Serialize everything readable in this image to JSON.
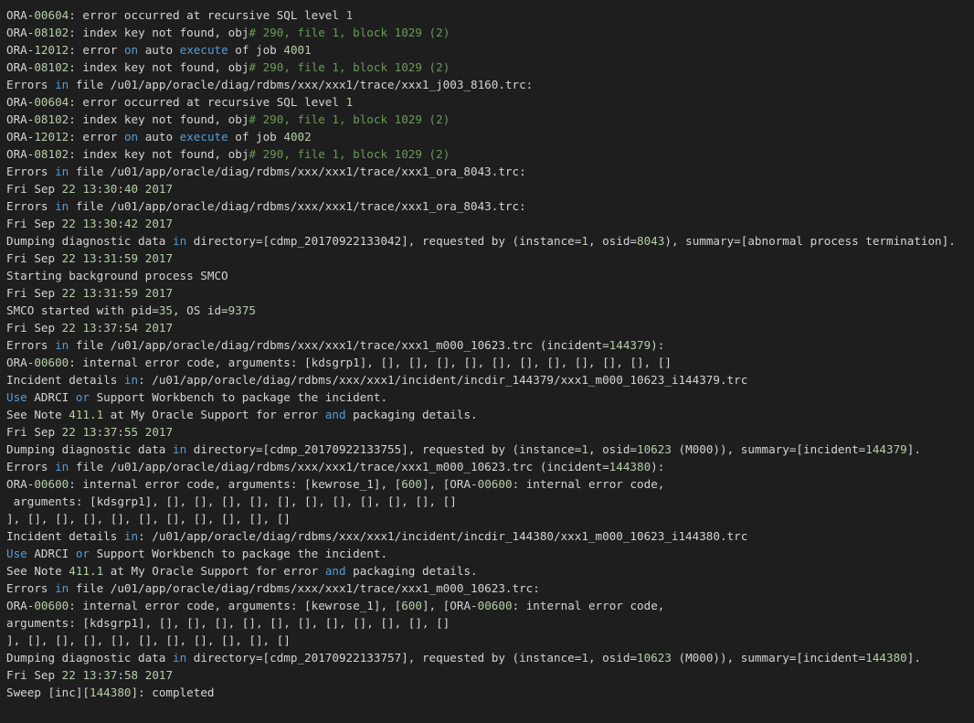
{
  "colors": {
    "background": "#1e1e1e",
    "text": "#d4d4d4",
    "keyword": "#569cd6",
    "number": "#b5cea8",
    "comment": "#6a9955"
  },
  "lines": [
    [
      [
        "t",
        "ORA-"
      ],
      [
        "n",
        "00604"
      ],
      [
        "t",
        ": error occurred at recursive SQL level "
      ],
      [
        "n",
        "1"
      ]
    ],
    [
      [
        "t",
        "ORA-"
      ],
      [
        "n",
        "08102"
      ],
      [
        "t",
        ": index key not found, obj"
      ],
      [
        "c",
        "# 290, file 1, block 1029 (2)"
      ]
    ],
    [
      [
        "t",
        "ORA-"
      ],
      [
        "n",
        "12012"
      ],
      [
        "t",
        ": error "
      ],
      [
        "k",
        "on"
      ],
      [
        "t",
        " auto "
      ],
      [
        "k",
        "execute"
      ],
      [
        "t",
        " of job "
      ],
      [
        "n",
        "4001"
      ]
    ],
    [
      [
        "t",
        "ORA-"
      ],
      [
        "n",
        "08102"
      ],
      [
        "t",
        ": index key not found, obj"
      ],
      [
        "c",
        "# 290, file 1, block 1029 (2)"
      ]
    ],
    [
      [
        "t",
        "Errors "
      ],
      [
        "k",
        "in"
      ],
      [
        "t",
        " file /u01/app/oracle/diag/rdbms/xxx/xxx1/trace/xxx1_j003_8160.trc:"
      ]
    ],
    [
      [
        "t",
        "ORA-"
      ],
      [
        "n",
        "00604"
      ],
      [
        "t",
        ": error occurred at recursive SQL level "
      ],
      [
        "n",
        "1"
      ]
    ],
    [
      [
        "t",
        "ORA-"
      ],
      [
        "n",
        "08102"
      ],
      [
        "t",
        ": index key not found, obj"
      ],
      [
        "c",
        "# 290, file 1, block 1029 (2)"
      ]
    ],
    [
      [
        "t",
        "ORA-"
      ],
      [
        "n",
        "12012"
      ],
      [
        "t",
        ": error "
      ],
      [
        "k",
        "on"
      ],
      [
        "t",
        " auto "
      ],
      [
        "k",
        "execute"
      ],
      [
        "t",
        " of job "
      ],
      [
        "n",
        "4002"
      ]
    ],
    [
      [
        "t",
        "ORA-"
      ],
      [
        "n",
        "08102"
      ],
      [
        "t",
        ": index key not found, obj"
      ],
      [
        "c",
        "# 290, file 1, block 1029 (2)"
      ]
    ],
    [
      [
        "t",
        "Errors "
      ],
      [
        "k",
        "in"
      ],
      [
        "t",
        " file /u01/app/oracle/diag/rdbms/xxx/xxx1/trace/xxx1_ora_8043.trc:"
      ]
    ],
    [
      [
        "t",
        "Fri Sep "
      ],
      [
        "n",
        "22"
      ],
      [
        "t",
        " "
      ],
      [
        "n",
        "13"
      ],
      [
        "t",
        ":"
      ],
      [
        "n",
        "30"
      ],
      [
        "t",
        ":"
      ],
      [
        "n",
        "40"
      ],
      [
        "t",
        " "
      ],
      [
        "n",
        "2017"
      ]
    ],
    [
      [
        "t",
        "Errors "
      ],
      [
        "k",
        "in"
      ],
      [
        "t",
        " file /u01/app/oracle/diag/rdbms/xxx/xxx1/trace/xxx1_ora_8043.trc:"
      ]
    ],
    [
      [
        "t",
        "Fri Sep "
      ],
      [
        "n",
        "22"
      ],
      [
        "t",
        " "
      ],
      [
        "n",
        "13"
      ],
      [
        "t",
        ":"
      ],
      [
        "n",
        "30"
      ],
      [
        "t",
        ":"
      ],
      [
        "n",
        "42"
      ],
      [
        "t",
        " "
      ],
      [
        "n",
        "2017"
      ]
    ],
    [
      [
        "t",
        "Dumping diagnostic data "
      ],
      [
        "k",
        "in"
      ],
      [
        "t",
        " directory=[cdmp_20170922133042], requested by (instance="
      ],
      [
        "n",
        "1"
      ],
      [
        "t",
        ", osid="
      ],
      [
        "n",
        "8043"
      ],
      [
        "t",
        "), summary=[abnormal process termination]."
      ]
    ],
    [
      [
        "t",
        "Fri Sep "
      ],
      [
        "n",
        "22"
      ],
      [
        "t",
        " "
      ],
      [
        "n",
        "13"
      ],
      [
        "t",
        ":"
      ],
      [
        "n",
        "31"
      ],
      [
        "t",
        ":"
      ],
      [
        "n",
        "59"
      ],
      [
        "t",
        " "
      ],
      [
        "n",
        "2017"
      ]
    ],
    [
      [
        "t",
        "Starting background process SMCO"
      ]
    ],
    [
      [
        "t",
        "Fri Sep "
      ],
      [
        "n",
        "22"
      ],
      [
        "t",
        " "
      ],
      [
        "n",
        "13"
      ],
      [
        "t",
        ":"
      ],
      [
        "n",
        "31"
      ],
      [
        "t",
        ":"
      ],
      [
        "n",
        "59"
      ],
      [
        "t",
        " "
      ],
      [
        "n",
        "2017"
      ]
    ],
    [
      [
        "t",
        "SMCO started with pid="
      ],
      [
        "n",
        "35"
      ],
      [
        "t",
        ", OS id="
      ],
      [
        "n",
        "9375"
      ]
    ],
    [
      [
        "t",
        "Fri Sep "
      ],
      [
        "n",
        "22"
      ],
      [
        "t",
        " "
      ],
      [
        "n",
        "13"
      ],
      [
        "t",
        ":"
      ],
      [
        "n",
        "37"
      ],
      [
        "t",
        ":"
      ],
      [
        "n",
        "54"
      ],
      [
        "t",
        " "
      ],
      [
        "n",
        "2017"
      ]
    ],
    [
      [
        "t",
        "Errors "
      ],
      [
        "k",
        "in"
      ],
      [
        "t",
        " file /u01/app/oracle/diag/rdbms/xxx/xxx1/trace/xxx1_m000_10623.trc (incident="
      ],
      [
        "n",
        "144379"
      ],
      [
        "t",
        "):"
      ]
    ],
    [
      [
        "t",
        "ORA-"
      ],
      [
        "n",
        "00600"
      ],
      [
        "t",
        ": internal error code, arguments: [kdsgrp1], [], [], [], [], [], [], [], [], [], [], []"
      ]
    ],
    [
      [
        "t",
        "Incident details "
      ],
      [
        "k",
        "in"
      ],
      [
        "t",
        ": /u01/app/oracle/diag/rdbms/xxx/xxx1/incident/incdir_144379/xxx1_m000_10623_i144379.trc"
      ]
    ],
    [
      [
        "k",
        "Use"
      ],
      [
        "t",
        " ADRCI "
      ],
      [
        "k",
        "or"
      ],
      [
        "t",
        " Support Workbench to package the incident."
      ]
    ],
    [
      [
        "t",
        "See Note "
      ],
      [
        "n",
        "411.1"
      ],
      [
        "t",
        " at My Oracle Support for error "
      ],
      [
        "k",
        "and"
      ],
      [
        "t",
        " packaging details."
      ]
    ],
    [
      [
        "t",
        "Fri Sep "
      ],
      [
        "n",
        "22"
      ],
      [
        "t",
        " "
      ],
      [
        "n",
        "13"
      ],
      [
        "t",
        ":"
      ],
      [
        "n",
        "37"
      ],
      [
        "t",
        ":"
      ],
      [
        "n",
        "55"
      ],
      [
        "t",
        " "
      ],
      [
        "n",
        "2017"
      ]
    ],
    [
      [
        "t",
        "Dumping diagnostic data "
      ],
      [
        "k",
        "in"
      ],
      [
        "t",
        " directory=[cdmp_20170922133755], requested by (instance="
      ],
      [
        "n",
        "1"
      ],
      [
        "t",
        ", osid="
      ],
      [
        "n",
        "10623"
      ],
      [
        "t",
        " (M000)), summary=[incident="
      ],
      [
        "n",
        "144379"
      ],
      [
        "t",
        "]."
      ]
    ],
    [
      [
        "t",
        "Errors "
      ],
      [
        "k",
        "in"
      ],
      [
        "t",
        " file /u01/app/oracle/diag/rdbms/xxx/xxx1/trace/xxx1_m000_10623.trc (incident="
      ],
      [
        "n",
        "144380"
      ],
      [
        "t",
        "):"
      ]
    ],
    [
      [
        "t",
        "ORA-"
      ],
      [
        "n",
        "00600"
      ],
      [
        "t",
        ": internal error code, arguments: [kewrose_1], ["
      ],
      [
        "n",
        "600"
      ],
      [
        "t",
        "], [ORA-"
      ],
      [
        "n",
        "00600"
      ],
      [
        "t",
        ": internal error code,"
      ]
    ],
    [
      [
        "t",
        " arguments: [kdsgrp1], [], [], [], [], [], [], [], [], [], [], []"
      ]
    ],
    [
      [
        "t",
        "], [], [], [], [], [], [], [], [], [], []"
      ]
    ],
    [
      [
        "t",
        "Incident details "
      ],
      [
        "k",
        "in"
      ],
      [
        "t",
        ": /u01/app/oracle/diag/rdbms/xxx/xxx1/incident/incdir_144380/xxx1_m000_10623_i144380.trc"
      ]
    ],
    [
      [
        "k",
        "Use"
      ],
      [
        "t",
        " ADRCI "
      ],
      [
        "k",
        "or"
      ],
      [
        "t",
        " Support Workbench to package the incident."
      ]
    ],
    [
      [
        "t",
        "See Note "
      ],
      [
        "n",
        "411.1"
      ],
      [
        "t",
        " at My Oracle Support for error "
      ],
      [
        "k",
        "and"
      ],
      [
        "t",
        " packaging details."
      ]
    ],
    [
      [
        "t",
        "Errors "
      ],
      [
        "k",
        "in"
      ],
      [
        "t",
        " file /u01/app/oracle/diag/rdbms/xxx/xxx1/trace/xxx1_m000_10623.trc:"
      ]
    ],
    [
      [
        "t",
        "ORA-"
      ],
      [
        "n",
        "00600"
      ],
      [
        "t",
        ": internal error code, arguments: [kewrose_1], ["
      ],
      [
        "n",
        "600"
      ],
      [
        "t",
        "], [ORA-"
      ],
      [
        "n",
        "00600"
      ],
      [
        "t",
        ": internal error code,"
      ]
    ],
    [
      [
        "t",
        "arguments: [kdsgrp1], [], [], [], [], [], [], [], [], [], [], []"
      ]
    ],
    [
      [
        "t",
        "], [], [], [], [], [], [], [], [], [], []"
      ]
    ],
    [
      [
        "t",
        "Dumping diagnostic data "
      ],
      [
        "k",
        "in"
      ],
      [
        "t",
        " directory=[cdmp_20170922133757], requested by (instance="
      ],
      [
        "n",
        "1"
      ],
      [
        "t",
        ", osid="
      ],
      [
        "n",
        "10623"
      ],
      [
        "t",
        " (M000)), summary=[incident="
      ],
      [
        "n",
        "144380"
      ],
      [
        "t",
        "]."
      ]
    ],
    [
      [
        "t",
        "Fri Sep "
      ],
      [
        "n",
        "22"
      ],
      [
        "t",
        " "
      ],
      [
        "n",
        "13"
      ],
      [
        "t",
        ":"
      ],
      [
        "n",
        "37"
      ],
      [
        "t",
        ":"
      ],
      [
        "n",
        "58"
      ],
      [
        "t",
        " "
      ],
      [
        "n",
        "2017"
      ]
    ],
    [
      [
        "t",
        "Sweep [inc]["
      ],
      [
        "n",
        "144380"
      ],
      [
        "t",
        "]: completed"
      ]
    ]
  ]
}
